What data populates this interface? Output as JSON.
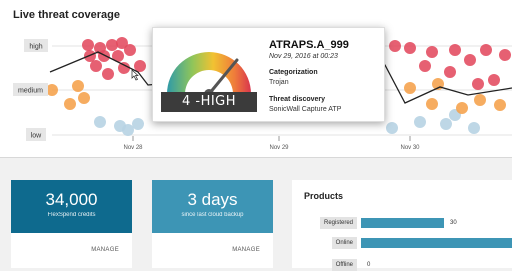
{
  "coverage": {
    "title": "Live threat coverage",
    "levels": [
      "high",
      "medium",
      "low"
    ],
    "dates": [
      "Nov 28",
      "Nov 29",
      "Nov 30"
    ]
  },
  "tooltip": {
    "level_text": "4 -HIGH",
    "name": "ATRAPS.A_999",
    "date": "Nov 29, 2016 at 00:23",
    "categorization_label": "Categorization",
    "categorization_value": "Trojan",
    "discovery_label": "Threat discovery",
    "discovery_value": "SonicWall Capture ATP"
  },
  "cards": [
    {
      "value": "34,000",
      "caption": "FlexSpend credits",
      "action": "MANAGE",
      "color": "#0e6a8e"
    },
    {
      "value": "3 days",
      "caption": "since last cloud backup",
      "action": "MANAGE",
      "color": "#3d95b5"
    }
  ],
  "products": {
    "title": "Products",
    "items": [
      {
        "label": "Registered",
        "value": "30",
        "fraction": 0.55
      },
      {
        "label": "Online",
        "value": "",
        "fraction": 1.0
      },
      {
        "label": "Offline",
        "value": "0",
        "fraction": 0
      }
    ]
  },
  "colors": {
    "high": "#e24a5e",
    "medium": "#f5a04a",
    "low": "#b7d3e3",
    "primary": "#0e6a8e",
    "secondary": "#3d95b5"
  }
}
